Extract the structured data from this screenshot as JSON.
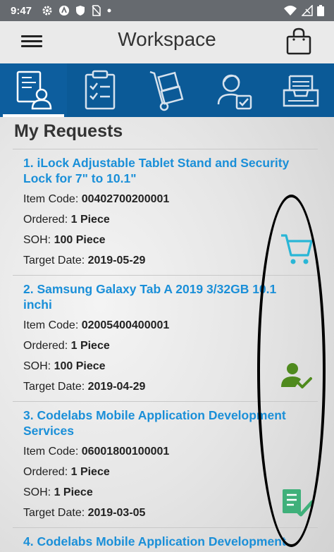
{
  "status_bar": {
    "time": "9:47",
    "icons": [
      "gear-icon",
      "app-icon",
      "shield-icon",
      "no-sim-icon",
      "dot-icon",
      "wifi-icon",
      "no-signal-icon",
      "battery-icon"
    ]
  },
  "app_bar": {
    "title": "Workspace",
    "menu_icon": "hamburger-menu-icon",
    "cart_icon": "shopping-bag-icon"
  },
  "tabs": [
    {
      "name": "my-requests",
      "icon": "document-user-icon",
      "active": true
    },
    {
      "name": "checklist",
      "icon": "clipboard-checklist-icon",
      "active": false
    },
    {
      "name": "delivery",
      "icon": "hand-truck-icon",
      "active": false
    },
    {
      "name": "approvals",
      "icon": "user-approve-icon",
      "active": false
    },
    {
      "name": "inbox",
      "icon": "inbox-tray-icon",
      "active": false
    }
  ],
  "section": {
    "title": "My Requests"
  },
  "labels": {
    "item_code": "Item Code: ",
    "ordered": "Ordered: ",
    "soh": "SOH: ",
    "target_date": "Target Date: "
  },
  "requests": [
    {
      "name": "1. iLock Adjustable Tablet Stand and Security Lock for 7\" to 10.1\"",
      "item_code": "00402700200001",
      "ordered": "1 Piece",
      "soh": "100 Piece",
      "target_date": "2019-05-29",
      "status_icon": "shopping-cart-icon",
      "status_color": "#29b6d6"
    },
    {
      "name": "2.  Samsung Galaxy Tab A 2019 3/32GB 10.1 inchi",
      "item_code": "02005400400001",
      "ordered": "1 Piece",
      "soh": "100 Piece",
      "target_date": "2019-04-29",
      "status_icon": "user-check-icon",
      "status_color": "#4f8a1e"
    },
    {
      "name": "3. Codelabs Mobile Application Development Services",
      "item_code": "06001800100001",
      "ordered": "1 Piece",
      "soh": "1 Piece",
      "target_date": "2019-03-05",
      "status_icon": "document-check-icon",
      "status_color": "#3fb07a"
    },
    {
      "name": "4. Codelabs Mobile Application Development"
    }
  ]
}
